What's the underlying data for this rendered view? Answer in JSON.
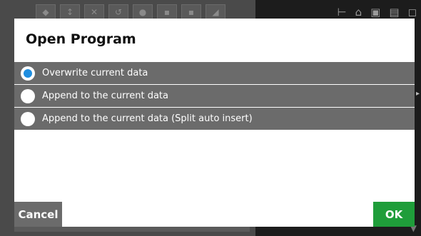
{
  "dialog": {
    "title": "Open Program",
    "options": [
      {
        "label": "Overwrite current data",
        "checked": true
      },
      {
        "label": "Append to the current data",
        "checked": false
      },
      {
        "label": "Append to the current data (Split auto insert)",
        "checked": false
      }
    ],
    "cancel_label": "Cancel",
    "ok_label": "OK"
  },
  "colors": {
    "option_bg": "#6b6b6b",
    "radio_selected": "#1f8ee0",
    "ok_button": "#1f9d3a",
    "cancel_button": "#6b6b6b"
  }
}
